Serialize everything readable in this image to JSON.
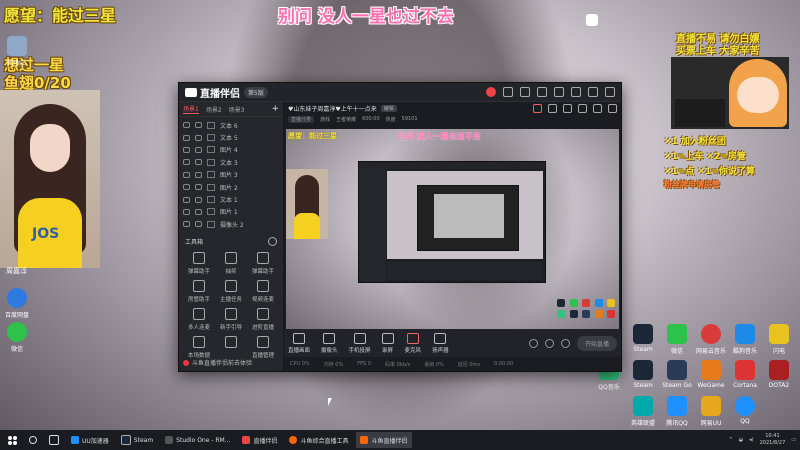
{
  "overlay": {
    "top_left_wish": "愿望：能过三星",
    "center_title": "别问 没人一星也过不去",
    "wish_star": "想过一星",
    "fish_wing": "鱼翅0/20",
    "cam_label": "周嘉淳"
  },
  "right_panel": {
    "title": "直播不易 请勿白嫖",
    "subtitle": "买票上车 大家辛苦",
    "gift_rows": [
      "✕1 加入粉丝团",
      "✕1=上车  ✕2=房管",
      "✕1=点  ✕1=你说了算",
      "粉丝牌申请房管"
    ]
  },
  "desktop_icons_left": [
    "回收站",
    "百度网盘",
    "微信"
  ],
  "desktop_icons_right": [
    "Steam",
    "微信",
    "网易云音乐",
    "酷狗音乐",
    "闪电",
    "QQ音乐",
    "Steam",
    "Steam Go",
    "WeGame",
    "Cortana",
    "DOTA2",
    "英雄联盟",
    "腾讯QQ",
    "网易UU",
    "QQ"
  ],
  "window": {
    "app_name": "直播伴侣",
    "version": "第5版",
    "side_tabs": [
      "场景1",
      "场景2",
      "场景3"
    ],
    "sources": [
      "文本 6",
      "文本 5",
      "图片 4",
      "文本 3",
      "图片 3",
      "图片 2",
      "文本 1",
      "图片 1",
      "摄像头 2"
    ],
    "tool_header": "工具箱",
    "tools": [
      "弹幕助手",
      "抽奖",
      "弹幕助手",
      "房管助手",
      "主播任务",
      "视频连麦",
      "多人连麦",
      "新手引导",
      "进阶直播",
      "本场数据",
      "",
      "直播管理"
    ],
    "side_status": "斗鱼直播伴侣前去体验",
    "room_title": "♥山东妹子周嘉淳♥上午十一点来",
    "room_edit": "编辑",
    "meta": [
      "直播分类",
      "游戏",
      "王者荣耀",
      "600:00",
      "热度",
      "59101"
    ],
    "preview_wish": "愿望：能过三星",
    "preview_title": "别问 没人一星也过不去",
    "bottom_buttons": [
      "直播画面",
      "摄像头",
      "手机投屏",
      "录屏",
      "麦克风",
      "扬声器"
    ],
    "start_live": "开始直播",
    "stats": [
      "CPU 0%",
      "内存 0%",
      "FPS 0",
      "码率 0kb/s",
      "丢帧 0%",
      "延迟 0ms",
      "0:00:00"
    ]
  },
  "taskbar": {
    "items": [
      "UU加速器",
      "Steam",
      "Studio One - RM...",
      "直播伴侣",
      "斗鱼综合直播工具",
      "斗鱼直播伴侣"
    ],
    "active_index": 5,
    "time": "10:41",
    "date": "2021/8/27"
  }
}
